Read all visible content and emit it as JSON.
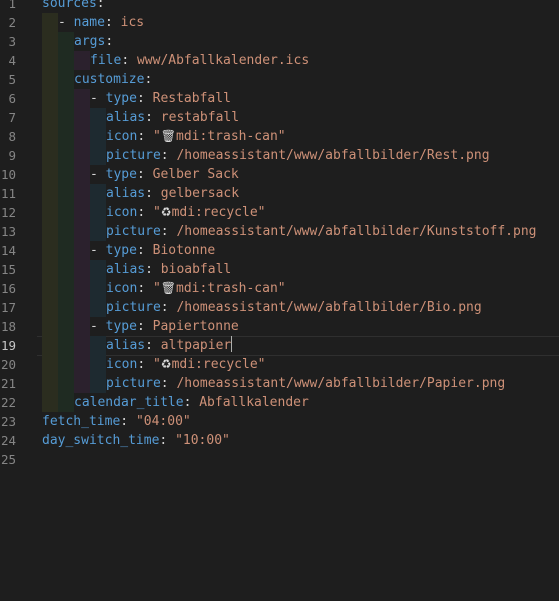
{
  "editor": {
    "current_line": 19,
    "lines": [
      {
        "n": "1",
        "indent": 0,
        "segs": [
          {
            "c": "k",
            "t": "sources"
          },
          {
            "c": "p",
            "t": ":"
          }
        ]
      },
      {
        "n": "2",
        "indent": 1,
        "segs": [
          {
            "c": "d",
            "t": "- "
          },
          {
            "c": "k",
            "t": "name"
          },
          {
            "c": "p",
            "t": ": "
          },
          {
            "c": "v",
            "t": "ics"
          }
        ]
      },
      {
        "n": "3",
        "indent": 2,
        "segs": [
          {
            "c": "k",
            "t": "args"
          },
          {
            "c": "p",
            "t": ":"
          }
        ]
      },
      {
        "n": "4",
        "indent": 3,
        "segs": [
          {
            "c": "k",
            "t": "file"
          },
          {
            "c": "p",
            "t": ": "
          },
          {
            "c": "v",
            "t": "www/Abfallkalender.ics"
          }
        ]
      },
      {
        "n": "5",
        "indent": 2,
        "segs": [
          {
            "c": "k",
            "t": "customize"
          },
          {
            "c": "p",
            "t": ":"
          }
        ]
      },
      {
        "n": "6",
        "indent": 3,
        "segs": [
          {
            "c": "d",
            "t": "- "
          },
          {
            "c": "k",
            "t": "type"
          },
          {
            "c": "p",
            "t": ": "
          },
          {
            "c": "v",
            "t": "Restabfall"
          }
        ]
      },
      {
        "n": "7",
        "indent": 4,
        "segs": [
          {
            "c": "k",
            "t": "alias"
          },
          {
            "c": "p",
            "t": ": "
          },
          {
            "c": "v",
            "t": "restabfall"
          }
        ]
      },
      {
        "n": "8",
        "indent": 4,
        "segs": [
          {
            "c": "k",
            "t": "icon"
          },
          {
            "c": "p",
            "t": ": "
          },
          {
            "c": "v",
            "t": "\""
          },
          {
            "c": "glyph",
            "t": "🗑"
          },
          {
            "c": "v",
            "t": "mdi:trash-can\""
          }
        ]
      },
      {
        "n": "9",
        "indent": 4,
        "segs": [
          {
            "c": "k",
            "t": "picture"
          },
          {
            "c": "p",
            "t": ": "
          },
          {
            "c": "v",
            "t": "/homeassistant/www/abfallbilder/Rest.png"
          }
        ]
      },
      {
        "n": "10",
        "indent": 3,
        "segs": [
          {
            "c": "d",
            "t": "- "
          },
          {
            "c": "k",
            "t": "type"
          },
          {
            "c": "p",
            "t": ": "
          },
          {
            "c": "v",
            "t": "Gelber Sack"
          }
        ]
      },
      {
        "n": "11",
        "indent": 4,
        "segs": [
          {
            "c": "k",
            "t": "alias"
          },
          {
            "c": "p",
            "t": ": "
          },
          {
            "c": "v",
            "t": "gelbersack"
          }
        ]
      },
      {
        "n": "12",
        "indent": 4,
        "segs": [
          {
            "c": "k",
            "t": "icon"
          },
          {
            "c": "p",
            "t": ": "
          },
          {
            "c": "v",
            "t": "\""
          },
          {
            "c": "glyph",
            "t": "♻"
          },
          {
            "c": "v",
            "t": "mdi:recycle\""
          }
        ]
      },
      {
        "n": "13",
        "indent": 4,
        "segs": [
          {
            "c": "k",
            "t": "picture"
          },
          {
            "c": "p",
            "t": ": "
          },
          {
            "c": "v",
            "t": "/homeassistant/www/abfallbilder/Kunststoff.png"
          }
        ]
      },
      {
        "n": "14",
        "indent": 3,
        "segs": [
          {
            "c": "d",
            "t": "- "
          },
          {
            "c": "k",
            "t": "type"
          },
          {
            "c": "p",
            "t": ": "
          },
          {
            "c": "v",
            "t": "Biotonne"
          }
        ]
      },
      {
        "n": "15",
        "indent": 4,
        "segs": [
          {
            "c": "k",
            "t": "alias"
          },
          {
            "c": "p",
            "t": ": "
          },
          {
            "c": "v",
            "t": "bioabfall"
          }
        ]
      },
      {
        "n": "16",
        "indent": 4,
        "segs": [
          {
            "c": "k",
            "t": "icon"
          },
          {
            "c": "p",
            "t": ": "
          },
          {
            "c": "v",
            "t": "\""
          },
          {
            "c": "glyph",
            "t": "🗑"
          },
          {
            "c": "v",
            "t": "mdi:trash-can\""
          }
        ]
      },
      {
        "n": "17",
        "indent": 4,
        "segs": [
          {
            "c": "k",
            "t": "picture"
          },
          {
            "c": "p",
            "t": ": "
          },
          {
            "c": "v",
            "t": "/homeassistant/www/abfallbilder/Bio.png"
          }
        ]
      },
      {
        "n": "18",
        "indent": 3,
        "segs": [
          {
            "c": "d",
            "t": "- "
          },
          {
            "c": "k",
            "t": "type"
          },
          {
            "c": "p",
            "t": ": "
          },
          {
            "c": "v",
            "t": "Papiertonne"
          }
        ]
      },
      {
        "n": "19",
        "indent": 4,
        "segs": [
          {
            "c": "k",
            "t": "alias"
          },
          {
            "c": "p",
            "t": ": "
          },
          {
            "c": "v",
            "t": "altpapier"
          }
        ],
        "caret": true
      },
      {
        "n": "20",
        "indent": 4,
        "segs": [
          {
            "c": "k",
            "t": "icon"
          },
          {
            "c": "p",
            "t": ": "
          },
          {
            "c": "v",
            "t": "\""
          },
          {
            "c": "glyph",
            "t": "♻"
          },
          {
            "c": "v",
            "t": "mdi:recycle\""
          }
        ]
      },
      {
        "n": "21",
        "indent": 4,
        "segs": [
          {
            "c": "k",
            "t": "picture"
          },
          {
            "c": "p",
            "t": ": "
          },
          {
            "c": "v",
            "t": "/homeassistant/www/abfallbilder/Papier.png"
          }
        ]
      },
      {
        "n": "22",
        "indent": 2,
        "segs": [
          {
            "c": "k",
            "t": "calendar_title"
          },
          {
            "c": "p",
            "t": ": "
          },
          {
            "c": "v",
            "t": "Abfallkalender"
          }
        ]
      },
      {
        "n": "23",
        "indent": 0,
        "segs": [
          {
            "c": "k",
            "t": "fetch_time"
          },
          {
            "c": "p",
            "t": ": "
          },
          {
            "c": "v",
            "t": "\"04:00\""
          }
        ]
      },
      {
        "n": "24",
        "indent": 0,
        "segs": [
          {
            "c": "k",
            "t": "day_switch_time"
          },
          {
            "c": "p",
            "t": ": "
          },
          {
            "c": "v",
            "t": "\"10:00\""
          }
        ]
      },
      {
        "n": "25",
        "indent": 0,
        "segs": []
      }
    ]
  }
}
